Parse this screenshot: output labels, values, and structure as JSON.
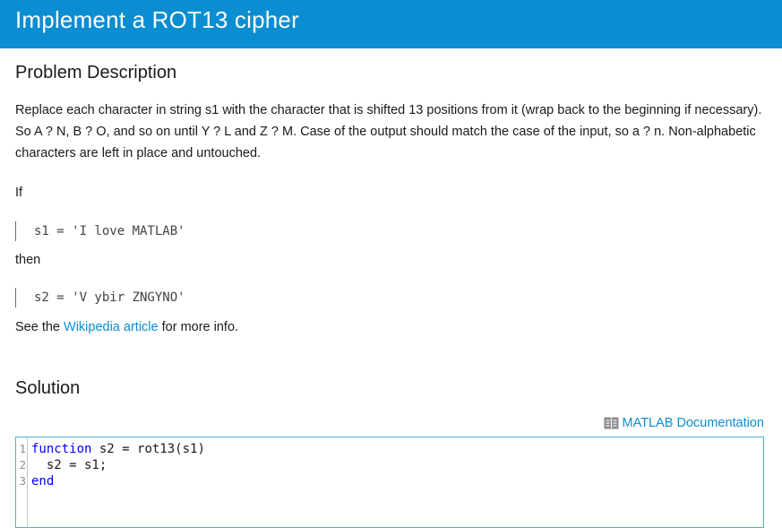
{
  "header": {
    "title": "Implement a ROT13 cipher"
  },
  "problem": {
    "heading": "Problem Description",
    "description": "Replace each character in string s1 with the character that is shifted 13 positions from it (wrap back to the beginning if necessary). So A ? N, B ? O, and so on until Y ? L and Z ? M. Case of the output should match the case of the input, so a ? n. Non-alphabetic characters are left in place and untouched.",
    "if_label": "If",
    "example_input": "s1 = 'I love MATLAB'",
    "then_label": "then",
    "example_output": "s2 = 'V ybir ZNGYNO'",
    "see_prefix": "See the ",
    "link_text": "Wikipedia article",
    "see_suffix": " for more info."
  },
  "solution": {
    "heading": "Solution",
    "doc_link": "MATLAB Documentation",
    "doc_icon": "book-icon",
    "lines": [
      {
        "num": "1",
        "keyword": "function",
        "rest": " s2 = rot13(s1)"
      },
      {
        "num": "2",
        "keyword": "",
        "rest": "  s2 = s1;"
      },
      {
        "num": "3",
        "keyword": "end",
        "rest": ""
      }
    ]
  },
  "colors": {
    "brand": "#0b8dd1",
    "keyword": "#0000ff",
    "editor_border": "#4fb0e0"
  }
}
